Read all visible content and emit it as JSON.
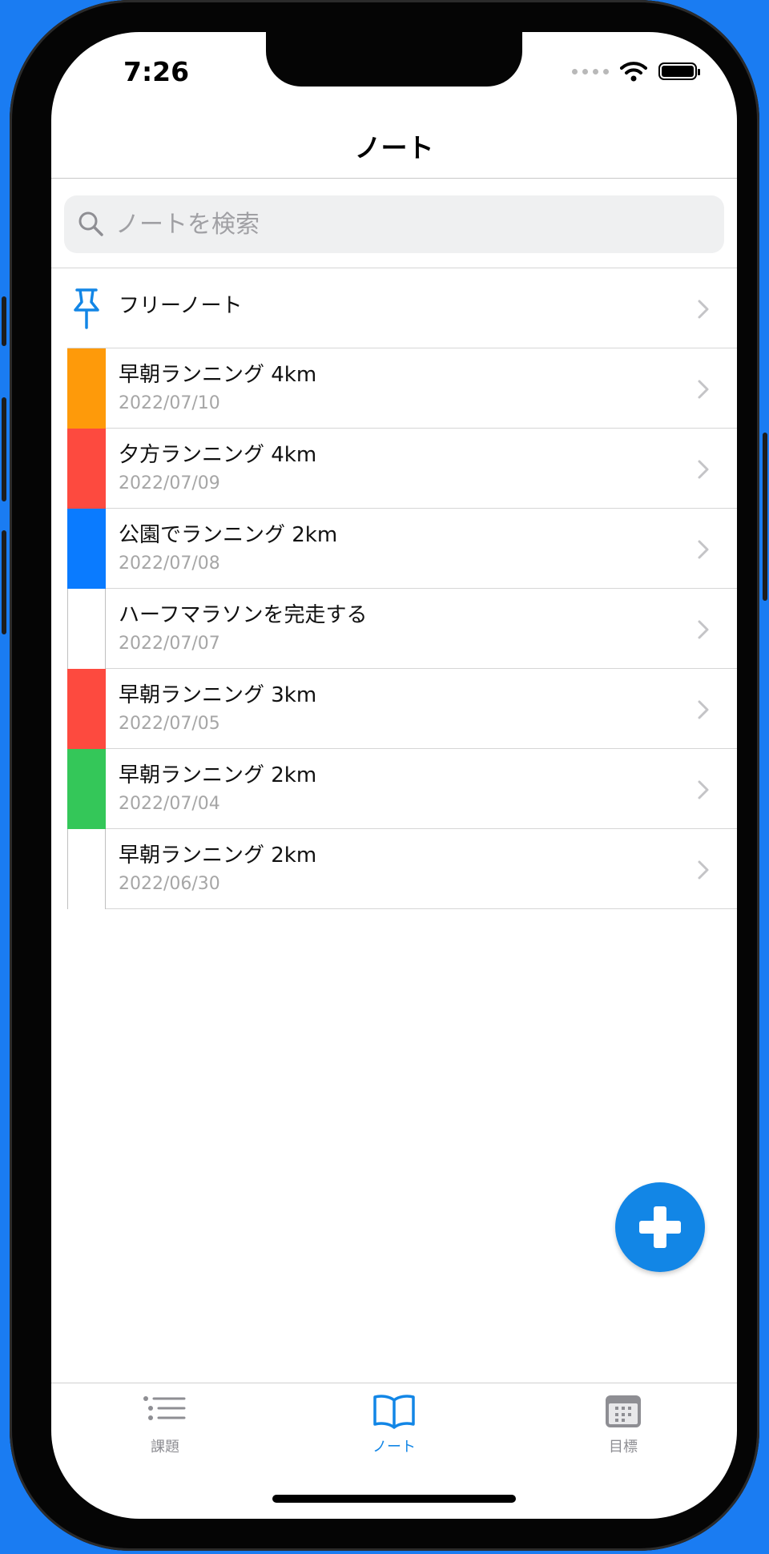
{
  "status_bar": {
    "time": "7:26"
  },
  "nav": {
    "title": "ノート"
  },
  "search": {
    "placeholder": "ノートを検索"
  },
  "pinned": {
    "label": "フリーノート"
  },
  "notes": [
    {
      "title": "早朝ランニング 4km",
      "date": "2022/07/10",
      "color": "#fe9a0a"
    },
    {
      "title": "夕方ランニング 4km",
      "date": "2022/07/09",
      "color": "#fd4a3f"
    },
    {
      "title": "公園でランニング 2km",
      "date": "2022/07/08",
      "color": "#0a7bff"
    },
    {
      "title": "ハーフマラソンを完走する",
      "date": "2022/07/07",
      "color": "#ffffff"
    },
    {
      "title": "早朝ランニング 3km",
      "date": "2022/07/05",
      "color": "#fd4a3f"
    },
    {
      "title": "早朝ランニング 2km",
      "date": "2022/07/04",
      "color": "#34c759"
    },
    {
      "title": "早朝ランニング 2km",
      "date": "2022/06/30",
      "color": "#ffffff"
    }
  ],
  "tabs": [
    {
      "label": "課題",
      "icon": "list-icon",
      "active": false
    },
    {
      "label": "ノート",
      "icon": "book-icon",
      "active": true
    },
    {
      "label": "目標",
      "icon": "calendar-icon",
      "active": false
    }
  ],
  "colors": {
    "accent": "#1286e6",
    "inactive_tab": "#8e8e93"
  }
}
